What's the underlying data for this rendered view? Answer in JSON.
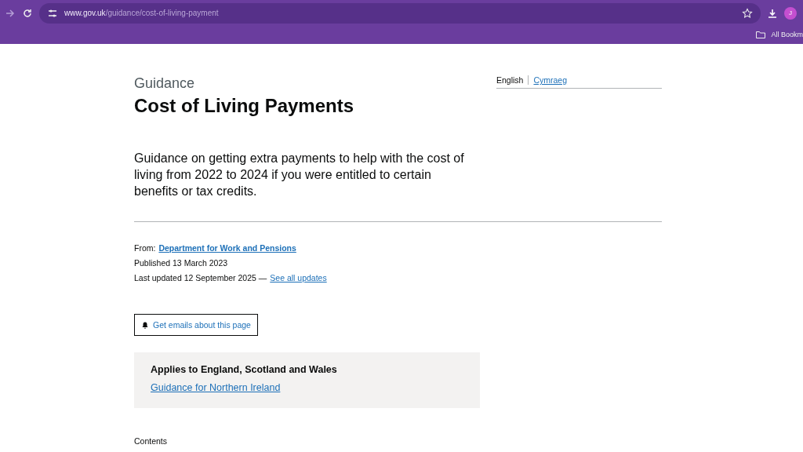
{
  "browser": {
    "url_host": "www.gov.uk",
    "url_path": "/guidance/cost-of-living-payment",
    "profile": "J",
    "bookmarks": "All Bookm"
  },
  "page": {
    "caption": "Guidance",
    "title": "Cost of Living Payments",
    "lead": "Guidance on getting extra payments to help with the cost of living from 2022 to 2024 if you were entitled to certain benefits or tax credits.",
    "languages": [
      {
        "label": "English",
        "selected": true
      },
      {
        "label": "Cymraeg",
        "selected": false
      }
    ],
    "from_label": "From:",
    "from_link": "Department for Work and Pensions",
    "published": "Published 13 March 2023",
    "updated": "Last updated 12 September 2025 —",
    "updates_link": "See all updates",
    "email_button": "Get emails about this page",
    "applies": {
      "heading": "Applies to England, Scotland and Wales",
      "link": "Guidance for Northern Ireland"
    },
    "contents_heading": "Contents"
  }
}
